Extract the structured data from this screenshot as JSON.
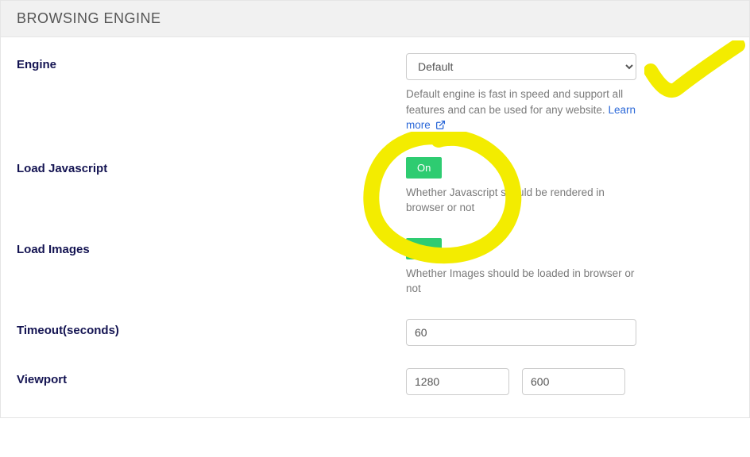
{
  "header": {
    "title": "BROWSING ENGINE"
  },
  "engine": {
    "label": "Engine",
    "selected": "Default",
    "help_prefix": "Default engine is fast in speed and support all features and can be used for any website.",
    "learn_more": "Learn more"
  },
  "load_js": {
    "label": "Load Javascript",
    "toggle": "On",
    "help": "Whether Javascript should be rendered in browser or not"
  },
  "load_images": {
    "label": "Load Images",
    "toggle": "On",
    "help": "Whether Images should be loaded in browser or not"
  },
  "timeout": {
    "label": "Timeout(seconds)",
    "value": "60"
  },
  "viewport": {
    "label": "Viewport",
    "width": "1280",
    "height": "600"
  }
}
